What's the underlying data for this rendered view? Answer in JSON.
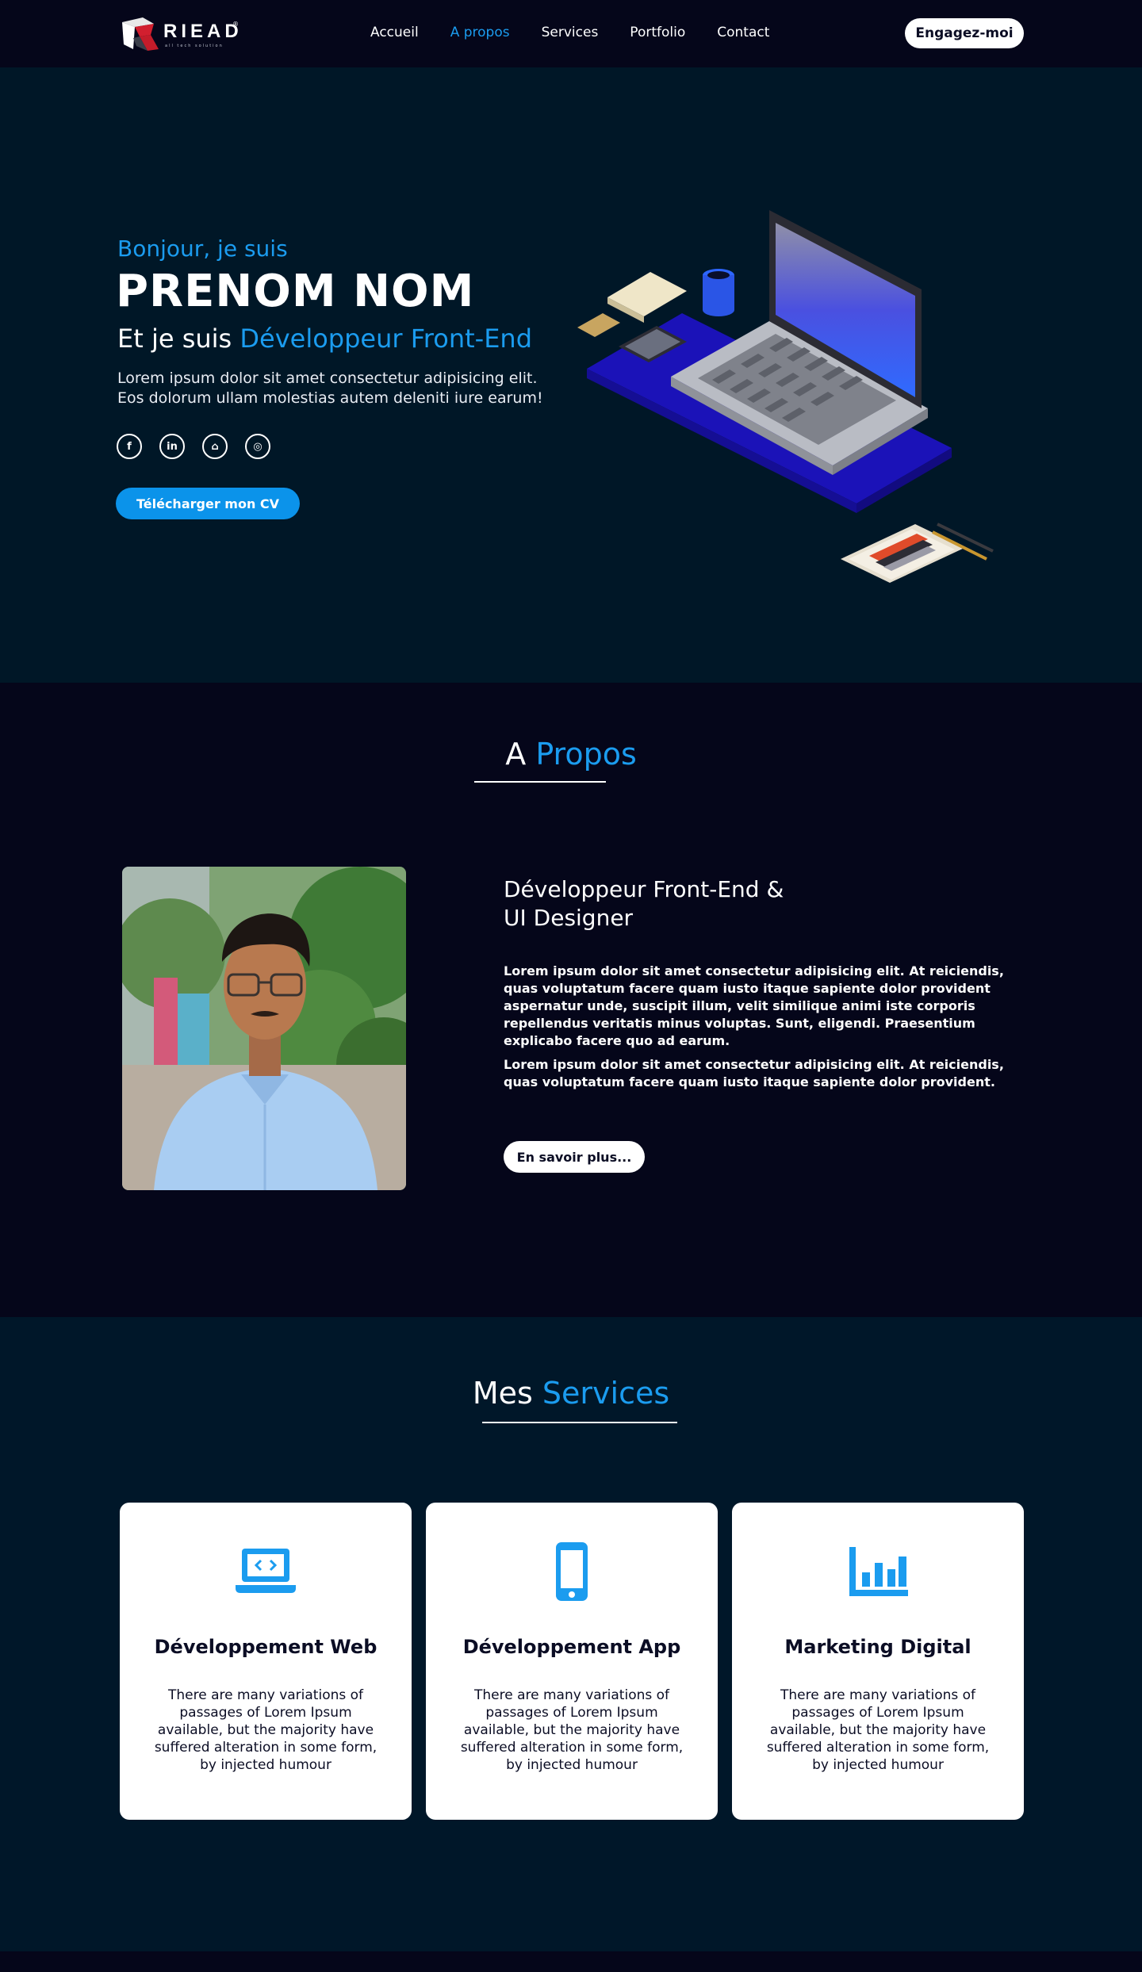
{
  "brand": {
    "logo_text": "RIEAD",
    "registered": "®",
    "tagline": "all tech solution"
  },
  "nav": {
    "links": [
      {
        "label": "Accueil",
        "active": false
      },
      {
        "label": "A propos",
        "active": true
      },
      {
        "label": "Services",
        "active": false
      },
      {
        "label": "Portfolio",
        "active": false
      },
      {
        "label": "Contact",
        "active": false
      }
    ],
    "cta_label": "Engagez-moi"
  },
  "hero": {
    "greeting": "Bonjour, je suis",
    "name": "PRENOM NOM",
    "role_prefix": "Et je suis",
    "role_highlight": "Développeur Front-End",
    "description": "Lorem ipsum dolor sit amet consectetur adipisicing elit. Eos dolorum ullam molestias autem deleniti iure earum!",
    "socials": [
      {
        "icon": "facebook-icon",
        "glyph": "f"
      },
      {
        "icon": "linkedin-icon",
        "glyph": "in"
      },
      {
        "icon": "github-icon",
        "glyph": "⌂"
      },
      {
        "icon": "instagram-icon",
        "glyph": "◎"
      }
    ],
    "cv_button": "Télécharger mon CV"
  },
  "about": {
    "title_prefix": "A",
    "title_highlight": "Propos",
    "heading_line1": "Développeur Front-End &",
    "heading_line2": "UI Designer",
    "paragraph1": "Lorem ipsum dolor sit amet consectetur adipisicing elit. At reiciendis, quas voluptatum facere quam iusto itaque sapiente dolor provident aspernatur unde, suscipit illum, velit similique animi iste corporis repellendus veritatis minus voluptas. Sunt, eligendi. Praesentium explicabo facere quo ad earum.",
    "paragraph2": "Lorem ipsum dolor sit amet consectetur adipisicing elit. At reiciendis, quas voluptatum facere quam iusto itaque sapiente dolor provident.",
    "more_button": "En savoir plus..."
  },
  "services": {
    "title_prefix": "Mes",
    "title_highlight": "Services",
    "cards": [
      {
        "icon": "laptop-code-icon",
        "title": "Développement Web",
        "text": "There are many variations of passages of Lorem Ipsum available, but the majority have suffered alteration in some form, by injected humour"
      },
      {
        "icon": "mobile-phone-icon",
        "title": "Développement App",
        "text": "There are many variations of passages of Lorem Ipsum available, but the majority have suffered alteration in some form, by injected humour"
      },
      {
        "icon": "bar-chart-icon",
        "title": "Marketing Digital",
        "text": "There are many variations of passages of Lorem Ipsum available, but the majority have suffered alteration in some form, by injected humour"
      }
    ]
  },
  "colors": {
    "accent": "#1b9cef",
    "background": "#05061a",
    "hero_bg": "#001727",
    "services_bg": "#001729",
    "card_bg": "#ffffff"
  }
}
